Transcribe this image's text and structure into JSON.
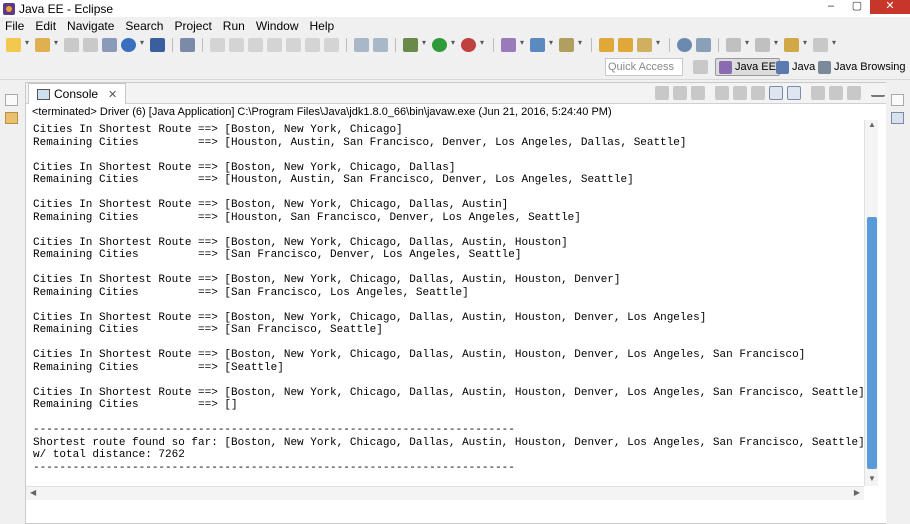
{
  "window": {
    "title": "Java EE - Eclipse",
    "controls": [
      "–",
      "▢",
      "✕"
    ]
  },
  "menu": {
    "items": [
      "File",
      "Edit",
      "Navigate",
      "Search",
      "Project",
      "Run",
      "Window",
      "Help"
    ]
  },
  "toolbar": {
    "quick_access_placeholder": "Quick Access",
    "perspectives": [
      {
        "label": "Java EE",
        "active": true
      },
      {
        "label": "Java",
        "active": false
      },
      {
        "label": "Java Browsing",
        "active": false
      }
    ]
  },
  "console_view": {
    "tab_label": "Console",
    "tab_close": "✕",
    "status": "<terminated> Driver (6) [Java Application] C:\\Program Files\\Java\\jdk1.8.0_66\\bin\\javaw.exe (Jun 21, 2016, 5:24:40 PM)",
    "lines": [
      "Cities In Shortest Route ==> [Boston, New York, Chicago]",
      "Remaining Cities         ==> [Houston, Austin, San Francisco, Denver, Los Angeles, Dallas, Seattle]",
      "",
      "Cities In Shortest Route ==> [Boston, New York, Chicago, Dallas]",
      "Remaining Cities         ==> [Houston, Austin, San Francisco, Denver, Los Angeles, Seattle]",
      "",
      "Cities In Shortest Route ==> [Boston, New York, Chicago, Dallas, Austin]",
      "Remaining Cities         ==> [Houston, San Francisco, Denver, Los Angeles, Seattle]",
      "",
      "Cities In Shortest Route ==> [Boston, New York, Chicago, Dallas, Austin, Houston]",
      "Remaining Cities         ==> [San Francisco, Denver, Los Angeles, Seattle]",
      "",
      "Cities In Shortest Route ==> [Boston, New York, Chicago, Dallas, Austin, Houston, Denver]",
      "Remaining Cities         ==> [San Francisco, Los Angeles, Seattle]",
      "",
      "Cities In Shortest Route ==> [Boston, New York, Chicago, Dallas, Austin, Houston, Denver, Los Angeles]",
      "Remaining Cities         ==> [San Francisco, Seattle]",
      "",
      "Cities In Shortest Route ==> [Boston, New York, Chicago, Dallas, Austin, Houston, Denver, Los Angeles, San Francisco]",
      "Remaining Cities         ==> [Seattle]",
      "",
      "Cities In Shortest Route ==> [Boston, New York, Chicago, Dallas, Austin, Houston, Denver, Los Angeles, San Francisco, Seattle]",
      "Remaining Cities         ==> []",
      "",
      "-------------------------------------------------------------------------",
      "Shortest route found so far: [Boston, New York, Chicago, Dallas, Austin, Houston, Denver, Los Angeles, San Francisco, Seattle]",
      "w/ total distance: 7262",
      "-------------------------------------------------------------------------"
    ]
  },
  "colors": {
    "scroll_thumb": "#5a9ad8",
    "close_button": "#c7362b"
  }
}
